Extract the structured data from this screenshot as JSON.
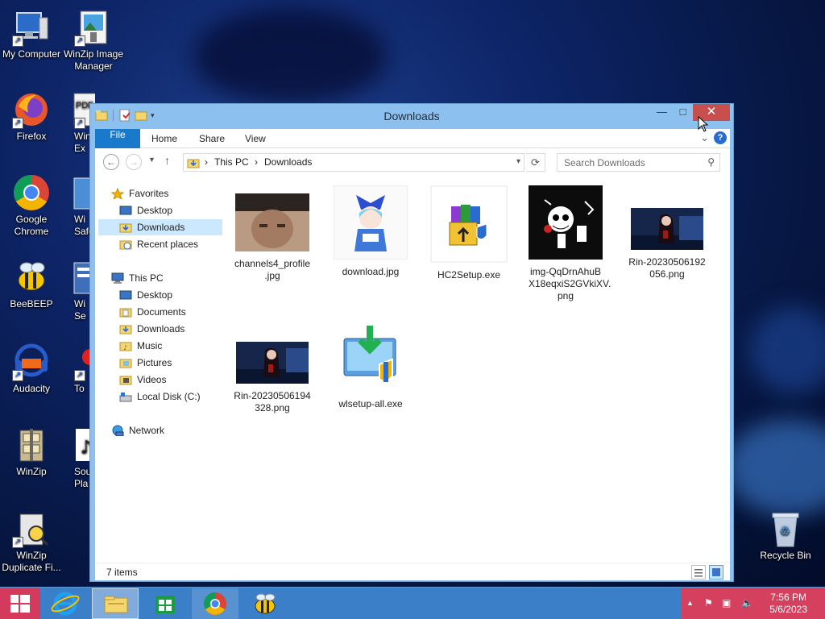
{
  "desktop": {
    "icons": [
      {
        "label": "My Computer"
      },
      {
        "label": "WinZip Image Manager"
      },
      {
        "label": "Firefox"
      },
      {
        "label": "WinZ Ex"
      },
      {
        "label": "Google Chrome"
      },
      {
        "label": "Wi Safe"
      },
      {
        "label": "BeeBEEP"
      },
      {
        "label": "Wi Se"
      },
      {
        "label": "Audacity"
      },
      {
        "label": "To"
      },
      {
        "label": "WinZip"
      },
      {
        "label": "Sou Pla"
      },
      {
        "label": "WinZip Duplicate Fi..."
      },
      {
        "label": "Recycle Bin"
      }
    ]
  },
  "window": {
    "title": "Downloads",
    "min_glyph": "—",
    "max_glyph": "□",
    "close_glyph": "✕",
    "tabs": {
      "file": "File",
      "home": "Home",
      "share": "Share",
      "view": "View"
    },
    "help_glyph": "?",
    "expand_glyph": "⌄",
    "address": {
      "crumbs": [
        "This PC",
        "Downloads"
      ],
      "separator": "›"
    },
    "search": {
      "placeholder": "Search Downloads"
    },
    "nav": {
      "favorites": "Favorites",
      "fav_items": [
        "Desktop",
        "Downloads",
        "Recent places"
      ],
      "this_pc": "This PC",
      "pc_items": [
        "Desktop",
        "Documents",
        "Downloads",
        "Music",
        "Pictures",
        "Videos",
        "Local Disk (C:)"
      ],
      "network": "Network"
    },
    "files": [
      {
        "name": "channels4_profile .jpg"
      },
      {
        "name": "download.jpg"
      },
      {
        "name": "HC2Setup.exe"
      },
      {
        "name": "img-QqDrnAhuB X18eqxiS2GVkiXV. png"
      },
      {
        "name": "Rin-20230506192 056.png"
      },
      {
        "name": "Rin-20230506194 328.png"
      },
      {
        "name": "wlsetup-all.exe"
      }
    ],
    "status": {
      "count": "7 items"
    }
  },
  "taskbar": {
    "clock_time": "7:56 PM",
    "clock_date": "5/6/2023",
    "tray_arrow": "▲"
  },
  "colors": {
    "accent": "#1979ca",
    "title_close": "#c7504e",
    "taskbar": "#3c7fc9",
    "tray": "#d4405e",
    "start": "#d43a5c",
    "selection": "#cce8ff"
  }
}
